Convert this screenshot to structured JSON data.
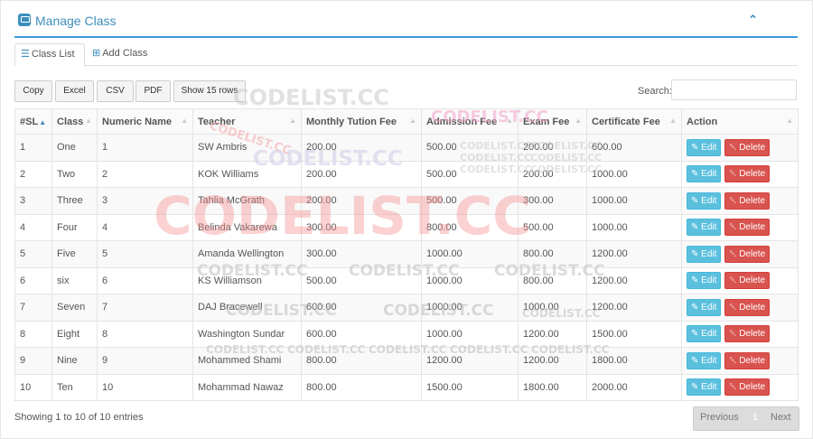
{
  "header": {
    "title": "Manage Class",
    "collapse_icon": "chevron-up-icon"
  },
  "tabs": [
    {
      "label": "Class List",
      "icon": "list-icon"
    },
    {
      "label": "Add Class",
      "icon": "plus-square-icon"
    }
  ],
  "toolbar": {
    "copy": "Copy",
    "excel": "Excel",
    "csv": "CSV",
    "pdf": "PDF",
    "show_rows": "Show 15 rows"
  },
  "search": {
    "label": "Search:",
    "value": ""
  },
  "table": {
    "columns": [
      "#SL",
      "Class",
      "Numeric Name",
      "Teacher",
      "Monthly Tution Fee",
      "Admission Fee",
      "Exam Fee",
      "Certificate Fee",
      "Action"
    ],
    "rows": [
      [
        "1",
        "One",
        "1",
        "SW Ambris",
        "200.00",
        "500.00",
        "200.00",
        "600.00"
      ],
      [
        "2",
        "Two",
        "2",
        "KOK Williams",
        "200.00",
        "500.00",
        "200.00",
        "1000.00"
      ],
      [
        "3",
        "Three",
        "3",
        "Tahlia McGrath",
        "200.00",
        "500.00",
        "300.00",
        "1000.00"
      ],
      [
        "4",
        "Four",
        "4",
        "Belinda Vakarewa",
        "300.00",
        "800.00",
        "500.00",
        "1000.00"
      ],
      [
        "5",
        "Five",
        "5",
        "Amanda Wellington",
        "300.00",
        "1000.00",
        "800.00",
        "1200.00"
      ],
      [
        "6",
        "six",
        "6",
        "KS Williamson",
        "500.00",
        "1000.00",
        "800.00",
        "1200.00"
      ],
      [
        "7",
        "Seven",
        "7",
        "DAJ Bracewell",
        "600.00",
        "1000.00",
        "1000.00",
        "1200.00"
      ],
      [
        "8",
        "Eight",
        "8",
        "Washington Sundar",
        "600.00",
        "1000.00",
        "1200.00",
        "1500.00"
      ],
      [
        "9",
        "Nine",
        "9",
        "Mohammed Shami",
        "800.00",
        "1200.00",
        "1200.00",
        "1800.00"
      ],
      [
        "10",
        "Ten",
        "10",
        "Mohammad Nawaz",
        "800.00",
        "1500.00",
        "1800.00",
        "2000.00"
      ]
    ],
    "edit_label": "Edit",
    "delete_label": "Delete"
  },
  "footer": {
    "info": "Showing 1 to 10 of 10 entries",
    "previous": "Previous",
    "page": "1",
    "next": "Next"
  },
  "watermark": {
    "text": "CODELIST.CC"
  },
  "colors": {
    "primary": "#3c8dbc",
    "edit": "#5bc0de",
    "delete": "#d9534f",
    "watermark_red": "#f4a6a6",
    "watermark_gray": "#c8c8c8",
    "watermark_pink": "#f0a0c8"
  }
}
